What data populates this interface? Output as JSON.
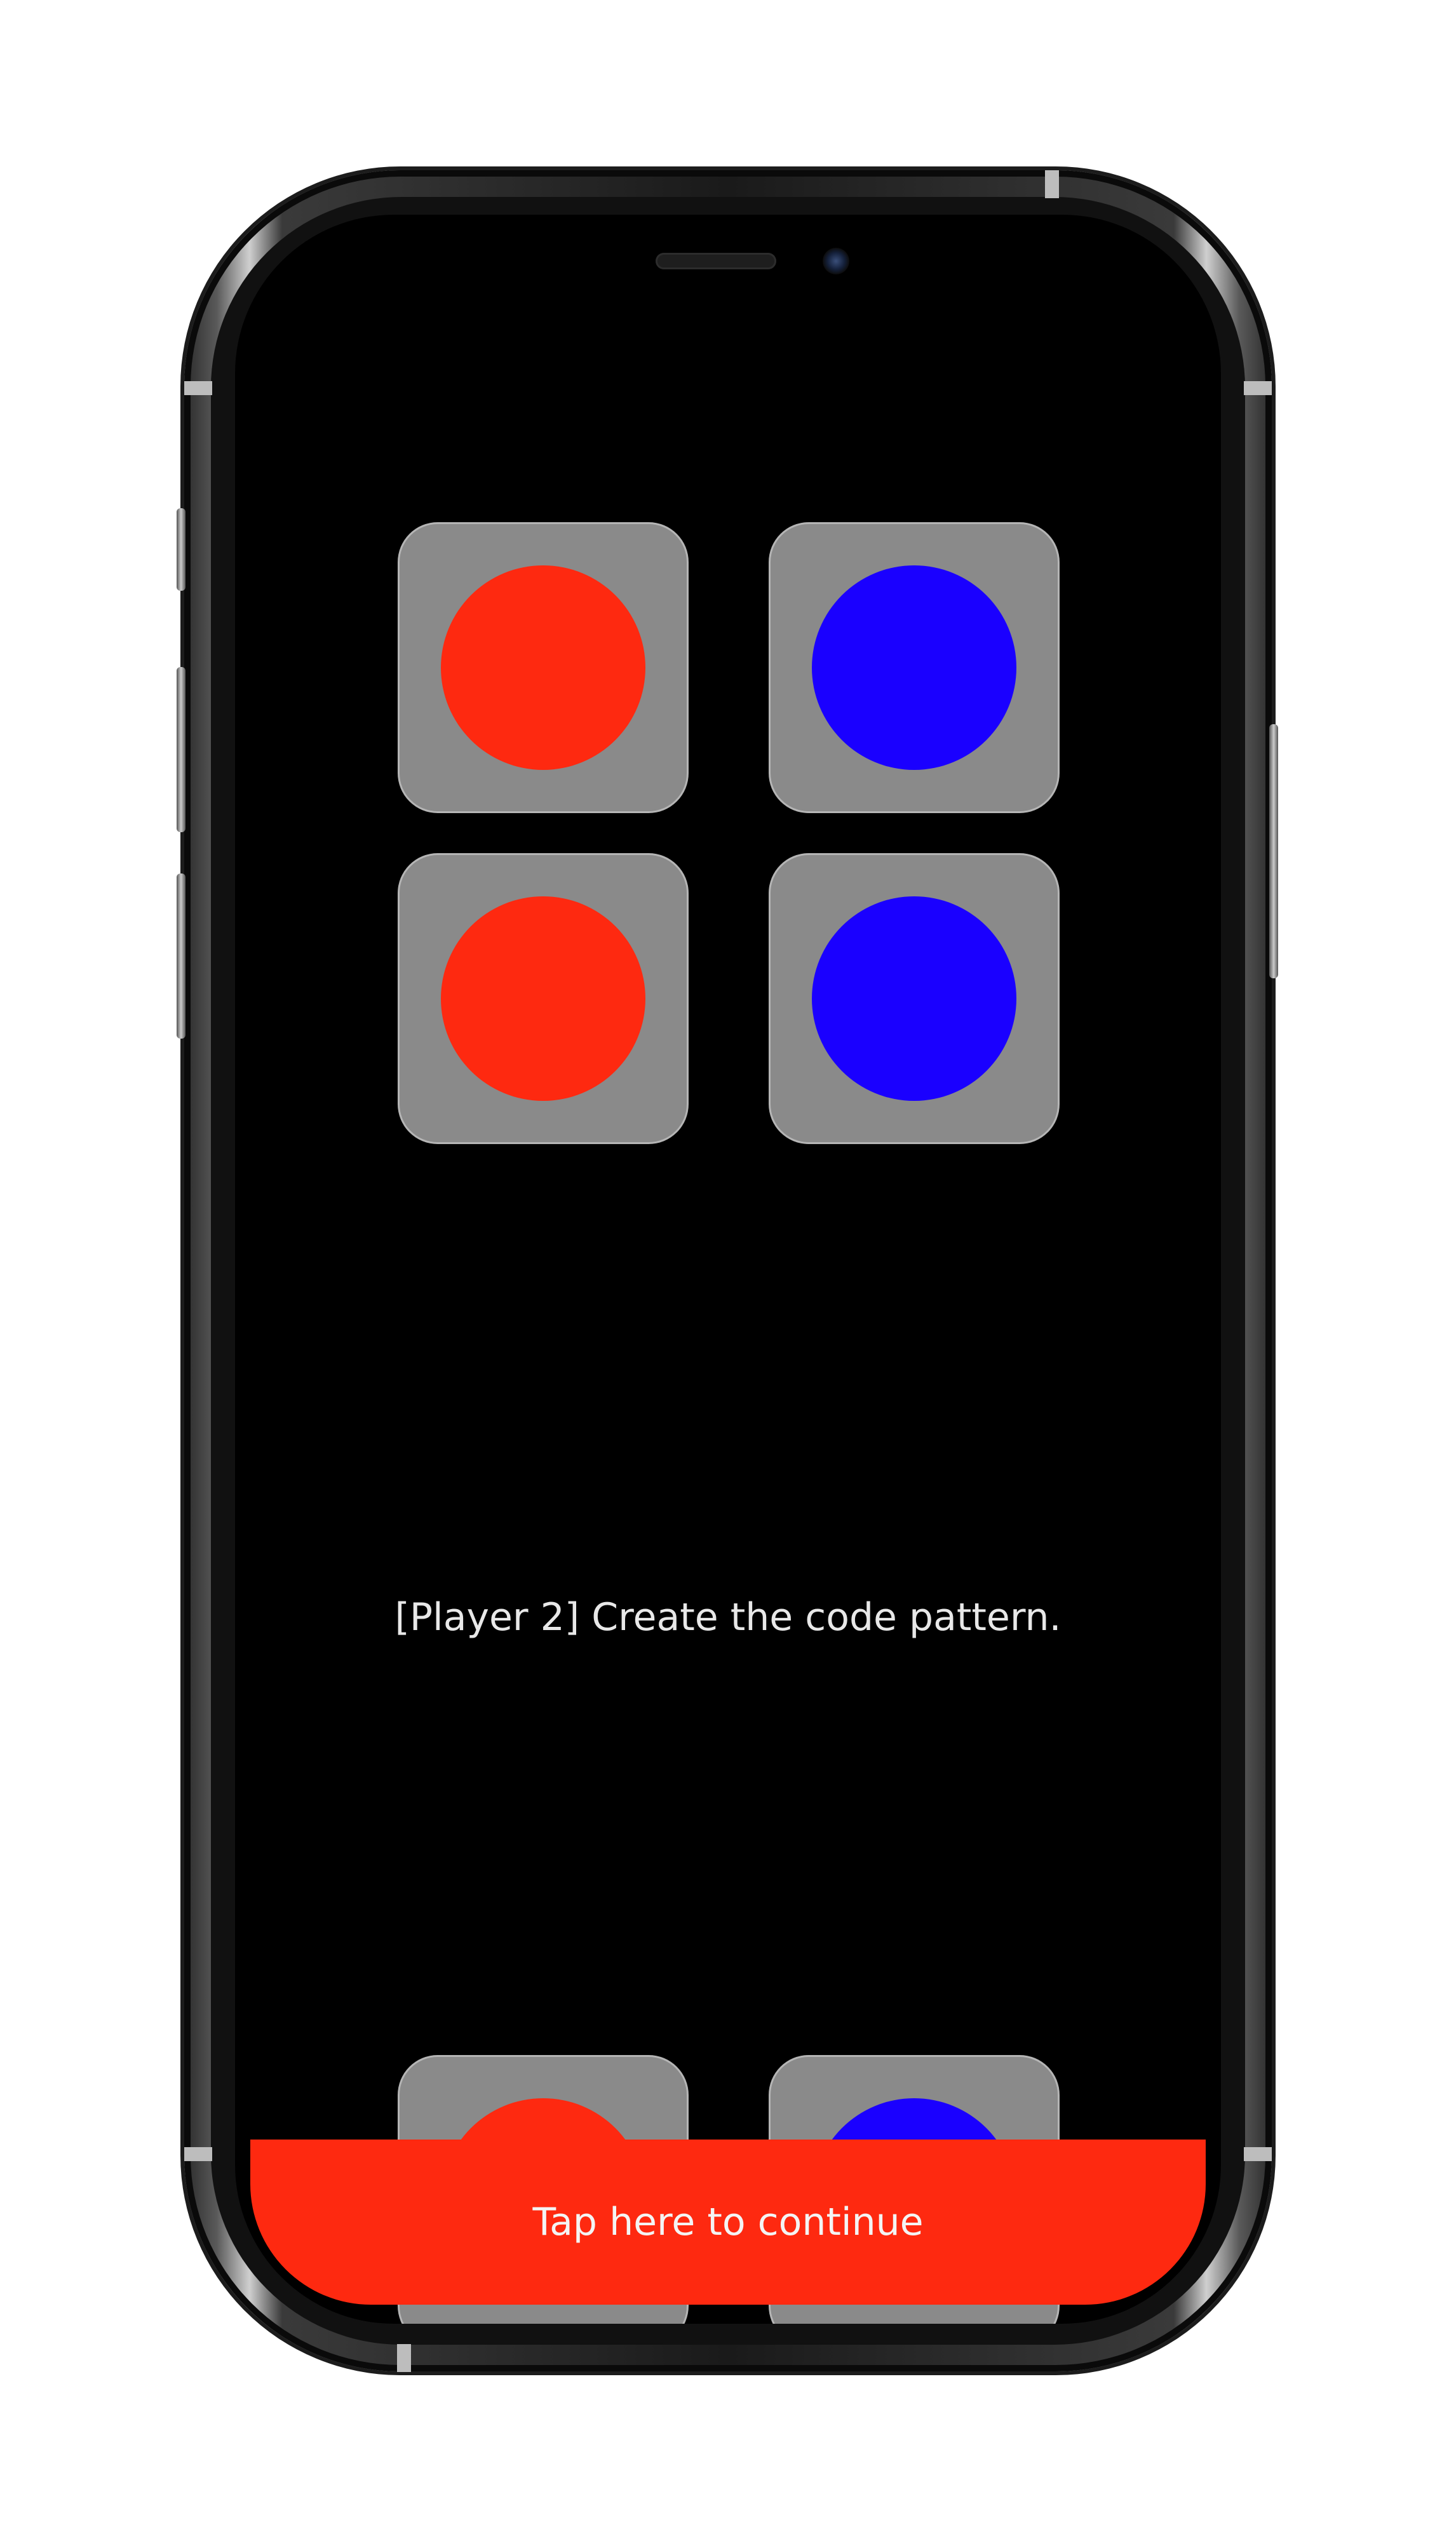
{
  "game": {
    "prompt": "[Player 2] Create the code pattern.",
    "continue_label": "Tap here to continue"
  },
  "tiles": [
    {
      "name": "top-left",
      "color": "#fe2910"
    },
    {
      "name": "top-right",
      "color": "#1a00ff"
    },
    {
      "name": "middle-left",
      "color": "#fe2910"
    },
    {
      "name": "middle-right",
      "color": "#1a00ff"
    },
    {
      "name": "bottom-left",
      "color": "#fe2910"
    },
    {
      "name": "bottom-right",
      "color": "#1a00ff"
    }
  ],
  "colors": {
    "red": "#fe2910",
    "blue": "#1a00ff",
    "tile": "#8a8a8a",
    "screen": "#000000"
  }
}
